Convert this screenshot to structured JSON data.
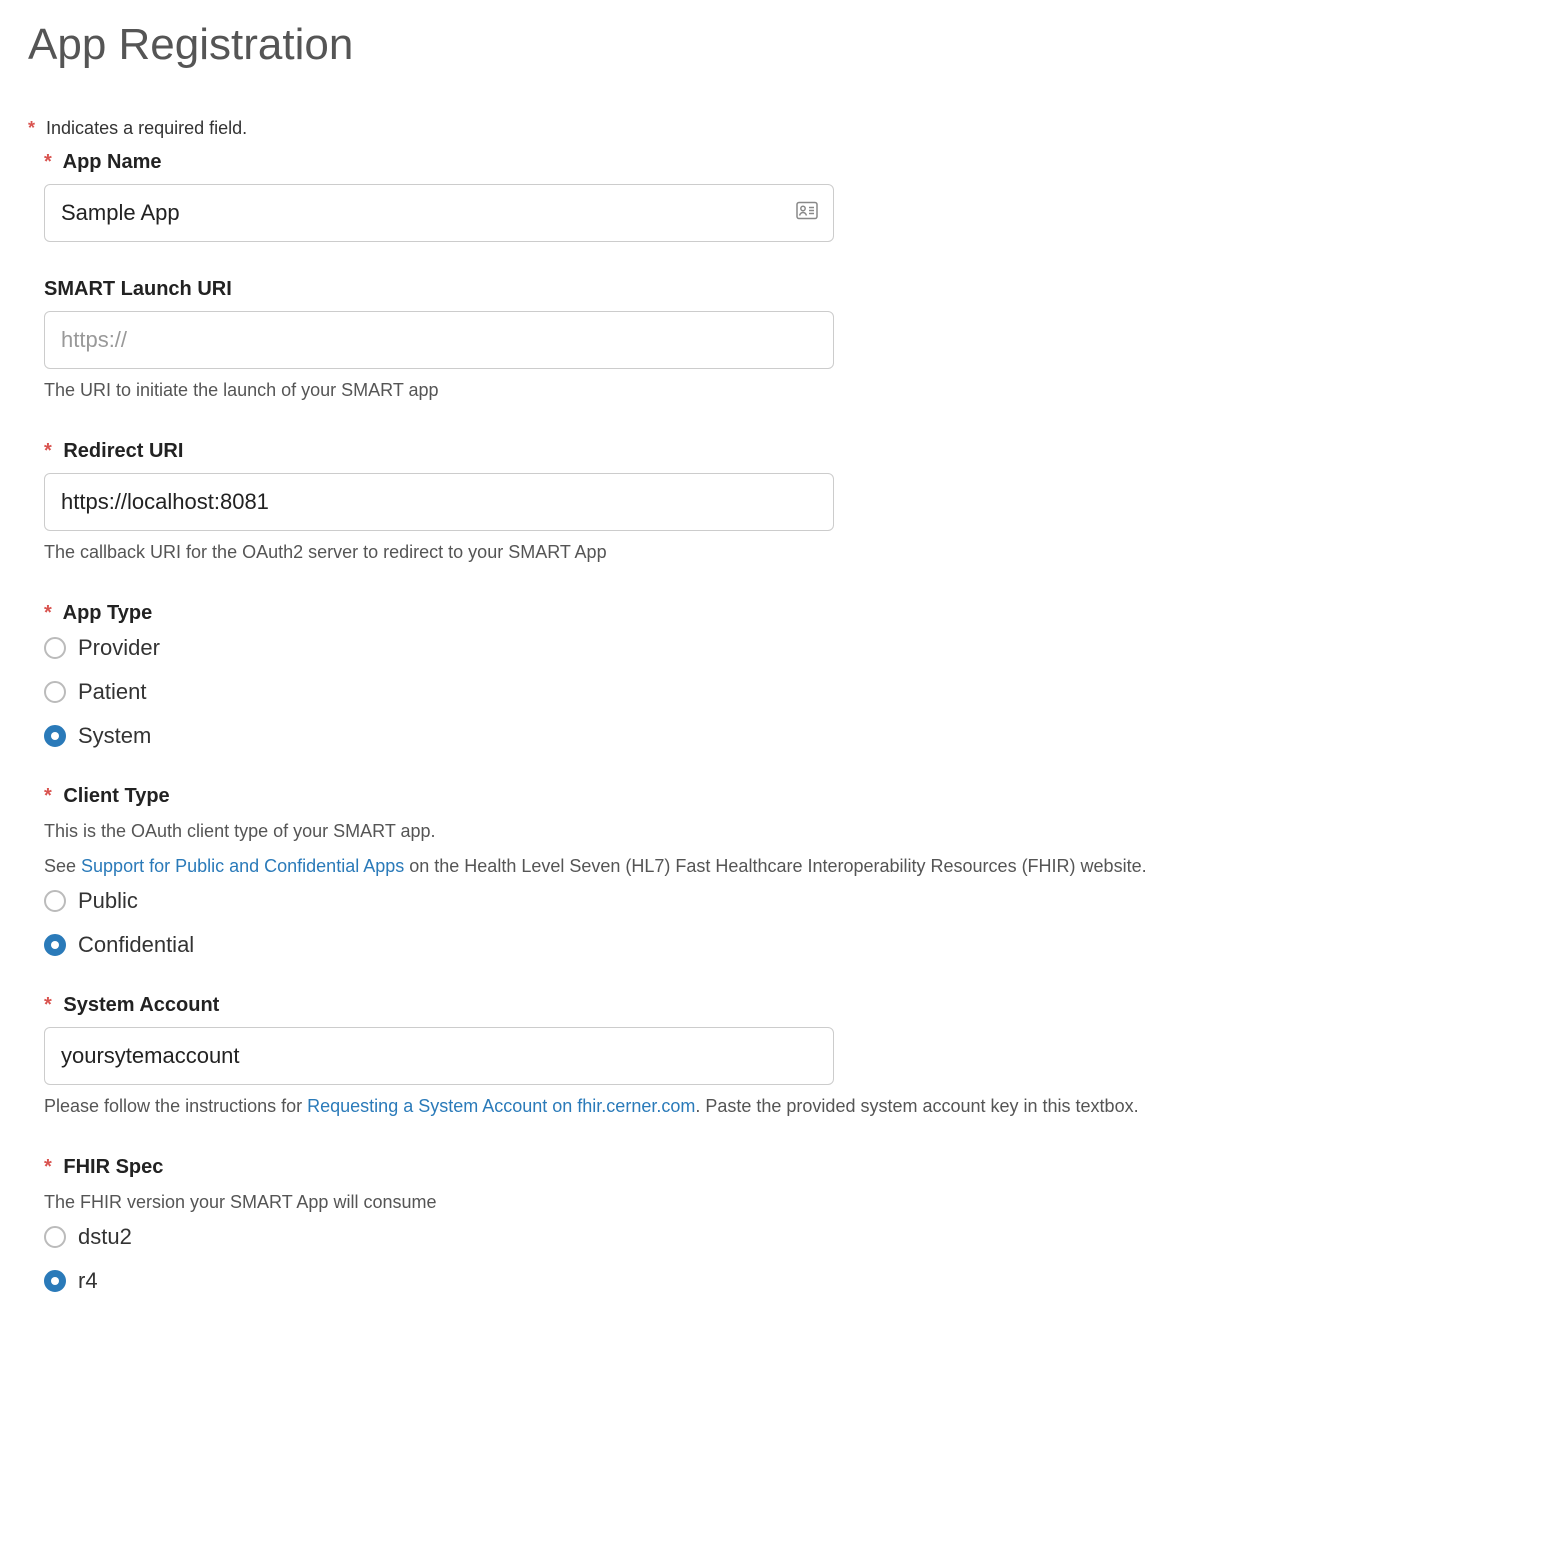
{
  "page_title": "App Registration",
  "required_note": "Indicates a required field.",
  "fields": {
    "app_name": {
      "label": "App Name",
      "value": "Sample App"
    },
    "smart_launch_uri": {
      "label": "SMART Launch URI",
      "placeholder": "https://",
      "value": "",
      "help": "The URI to initiate the launch of your SMART app"
    },
    "redirect_uri": {
      "label": "Redirect URI",
      "value": "https://localhost:8081",
      "help": "The callback URI for the OAuth2 server to redirect to your SMART App"
    },
    "app_type": {
      "label": "App Type",
      "options": {
        "provider": "Provider",
        "patient": "Patient",
        "system": "System"
      }
    },
    "client_type": {
      "label": "Client Type",
      "desc_prefix": "This is the OAuth client type of your SMART app.",
      "desc_see": "See ",
      "desc_link": "Support for Public and Confidential Apps",
      "desc_suffix": " on the Health Level Seven (HL7) Fast Healthcare Interoperability Resources (FHIR) website.",
      "options": {
        "public": "Public",
        "confidential": "Confidential"
      }
    },
    "system_account": {
      "label": "System Account",
      "value": "yoursytemaccount",
      "help_prefix": "Please follow the instructions for ",
      "help_link": "Requesting a System Account on fhir.cerner.com",
      "help_suffix": ". Paste the provided system account key in this textbox."
    },
    "fhir_spec": {
      "label": "FHIR Spec",
      "help": "The FHIR version your SMART App will consume",
      "options": {
        "dstu2": "dstu2",
        "r4": "r4"
      }
    }
  }
}
